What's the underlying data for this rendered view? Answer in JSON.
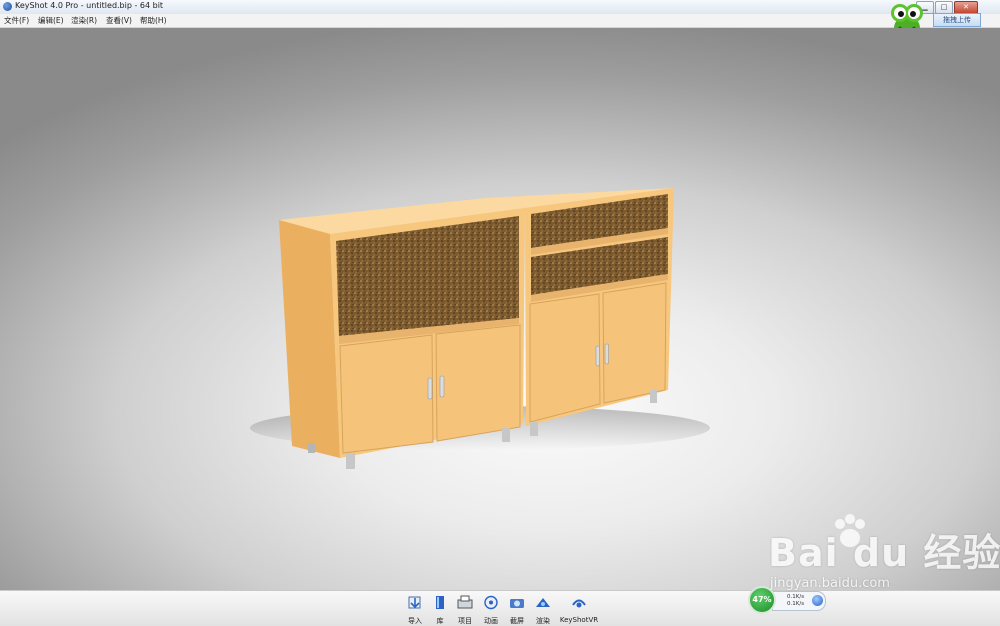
{
  "window": {
    "title": "KeyShot 4.0 Pro  - untitled.bip  - 64 bit",
    "minimize_icon": "minimize-icon",
    "maximize_icon": "maximize-icon",
    "close_icon": "close-icon"
  },
  "menu": {
    "items": [
      {
        "label": "文件(F)"
      },
      {
        "label": "编辑(E)"
      },
      {
        "label": "渲染(R)"
      },
      {
        "label": "查看(V)"
      },
      {
        "label": "帮助(H)"
      }
    ]
  },
  "overlay": {
    "upload_label": "拖拽上传"
  },
  "ribbon": {
    "tools": [
      {
        "label": "导入",
        "icon": "import-icon"
      },
      {
        "label": "库",
        "icon": "library-icon"
      },
      {
        "label": "项目",
        "icon": "project-icon"
      },
      {
        "label": "动画",
        "icon": "animation-icon"
      },
      {
        "label": "截屏",
        "icon": "screenshot-icon"
      },
      {
        "label": "渲染",
        "icon": "render-icon"
      },
      {
        "label": "KeyShotVR",
        "icon": "keyshotvr-icon"
      }
    ]
  },
  "net_monitor": {
    "percent": "47%",
    "upload": "0.1K/s",
    "download": "0.1K/s"
  },
  "watermark": {
    "brand": "Bai du 经验",
    "url": "jingyan.baidu.com"
  },
  "colors": {
    "cabinet_front": "#f7c77d",
    "cabinet_side": "#eab05f",
    "shelf_interior": "#8a6a3a",
    "handle": "#d9d9d9"
  }
}
